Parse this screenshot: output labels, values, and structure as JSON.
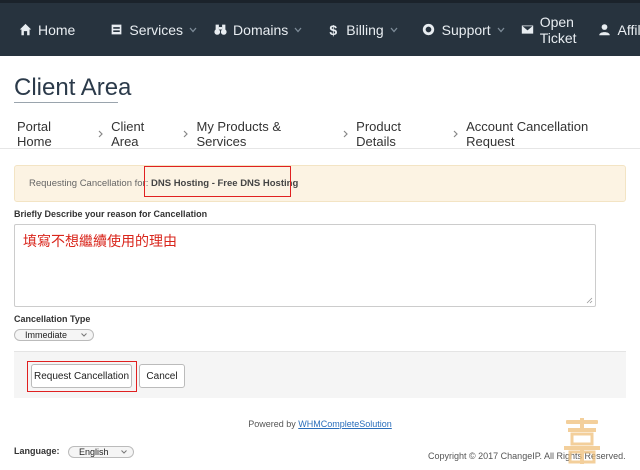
{
  "nav": {
    "items": [
      {
        "label": "Home",
        "icon": "home-icon",
        "dropdown": false
      },
      {
        "label": "Services",
        "icon": "cube-icon",
        "dropdown": true
      },
      {
        "label": "Domains",
        "icon": "binoculars-icon",
        "dropdown": true
      },
      {
        "label": "Billing",
        "icon": "dollar-icon",
        "dropdown": true
      },
      {
        "label": "Support",
        "icon": "lifebuoy-icon",
        "dropdown": true
      },
      {
        "label": "Open Ticket",
        "icon": "envelope-icon",
        "dropdown": false
      },
      {
        "label": "Affiliates",
        "icon": "user-icon",
        "dropdown": false
      }
    ]
  },
  "page": {
    "title": "Client Area"
  },
  "breadcrumb": [
    "Portal Home",
    "Client Area",
    "My Products & Services",
    "Product Details",
    "Account Cancellation Request"
  ],
  "alert": {
    "prefix": "Requesting Cancellation for:",
    "product": "DNS Hosting - Free DNS Hosting"
  },
  "form": {
    "reason_label": "Briefly Describe your reason for Cancellation",
    "reason_value": "填寫不想繼續使用的理由",
    "type_label": "Cancellation Type",
    "type_value": "Immediate",
    "submit_label": "Request Cancellation",
    "cancel_label": "Cancel"
  },
  "footer": {
    "powered_prefix": "Powered by",
    "powered_link": "WHMCompleteSolution",
    "language_label": "Language:",
    "language_value": "English",
    "copyright": "Copyright © 2017 ChangeIP. All Rights Reserved."
  },
  "colors": {
    "nav_bg": "#27333e",
    "alert_bg": "#fcf3e3",
    "highlight": "#e02020",
    "reason_text": "#d9261c",
    "link": "#2a6ebb"
  }
}
